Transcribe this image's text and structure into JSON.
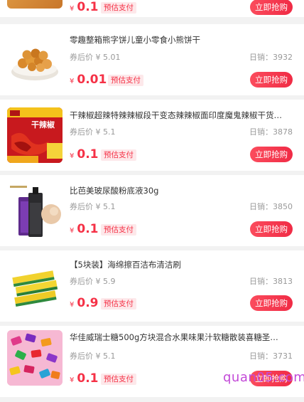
{
  "top_item": {
    "price_symbol": "¥",
    "price": "0.1",
    "tag": "预估支付",
    "buy_label": "立即抢购"
  },
  "items": [
    {
      "title": "零趣整箱熊字饼儿童小零食小熊饼干",
      "coupon_price": "券后价 ¥ 5.01",
      "sales": "日销：3932",
      "price_symbol": "¥",
      "price": "0.01",
      "tag": "预估支付",
      "buy_label": "立即抢购"
    },
    {
      "title": "干辣椒超辣特辣辣椒段干变态辣辣椒面印度魔鬼辣椒干货…",
      "coupon_price": "券后价 ¥ 5.1",
      "sales": "日销：3878",
      "price_symbol": "¥",
      "price": "0.1",
      "tag": "预估支付",
      "buy_label": "立即抢购",
      "thumb_text": "干辣椒"
    },
    {
      "title": "比芭美玻尿酸粉底液30g",
      "coupon_price": "券后价 ¥ 5.1",
      "sales": "日销：3850",
      "price_symbol": "¥",
      "price": "0.1",
      "tag": "预估支付",
      "buy_label": "立即抢购"
    },
    {
      "title": "【5块装】海绵擦百洁布清洁刷",
      "coupon_price": "券后价 ¥ 5.9",
      "sales": "日销：3813",
      "price_symbol": "¥",
      "price": "0.9",
      "tag": "预估支付",
      "buy_label": "立即抢购"
    },
    {
      "title": "华佳威瑞士糖500g方块混合水果味果汁软糖散装喜糖圣…",
      "coupon_price": "券后价 ¥ 5.1",
      "sales": "日销：3731",
      "price_symbol": "¥",
      "price": "0.1",
      "tag": "预估支付",
      "buy_label": "立即抢购"
    }
  ],
  "watermark": "quan05.com",
  "colors": {
    "accent": "#f53146",
    "tag_bg": "#fde8ea",
    "page_bg": "#f2f2f2"
  }
}
